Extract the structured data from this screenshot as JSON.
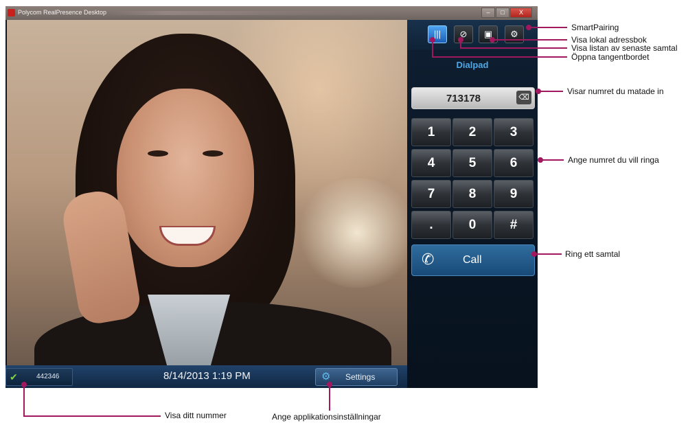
{
  "window": {
    "title": "Polycom RealPresence Desktop",
    "controls": [
      "–",
      "□",
      "X"
    ]
  },
  "statusbar": {
    "my_number": "442346",
    "datetime": "8/14/2013 1:19 PM",
    "settings_label": "Settings"
  },
  "panel": {
    "top_icons": [
      {
        "name": "dialpad-icon",
        "glyph": "|||",
        "active": true
      },
      {
        "name": "recent-calls-icon",
        "glyph": "⊘",
        "active": false
      },
      {
        "name": "address-book-icon",
        "glyph": "▣",
        "active": false
      },
      {
        "name": "smartpairing-icon",
        "glyph": "⚙",
        "active": false
      }
    ],
    "title": "Dialpad",
    "entered_number": "713178",
    "backspace_glyph": "⌫",
    "keys": [
      "1",
      "2",
      "3",
      "4",
      "5",
      "6",
      "7",
      "8",
      "9",
      ".",
      "0",
      "#"
    ],
    "call_label": "Call"
  },
  "annotations": {
    "smartpairing": "SmartPairing",
    "address_book": "Visa lokal adressbok",
    "recent_calls": "Visa listan av senaste samtal",
    "open_keypad": "Öppna tangentbordet",
    "shows_number": "Visar numret du matade in",
    "enter_number": "Ange numret du vill ringa",
    "make_call": "Ring ett samtal",
    "show_my_number": "Visa ditt nummer",
    "app_settings": "Ange applikationsinställningar"
  },
  "colors": {
    "annotation": "#a2185e",
    "accent_blue": "#4fa7e6",
    "panel_bg": "#0b1622"
  }
}
